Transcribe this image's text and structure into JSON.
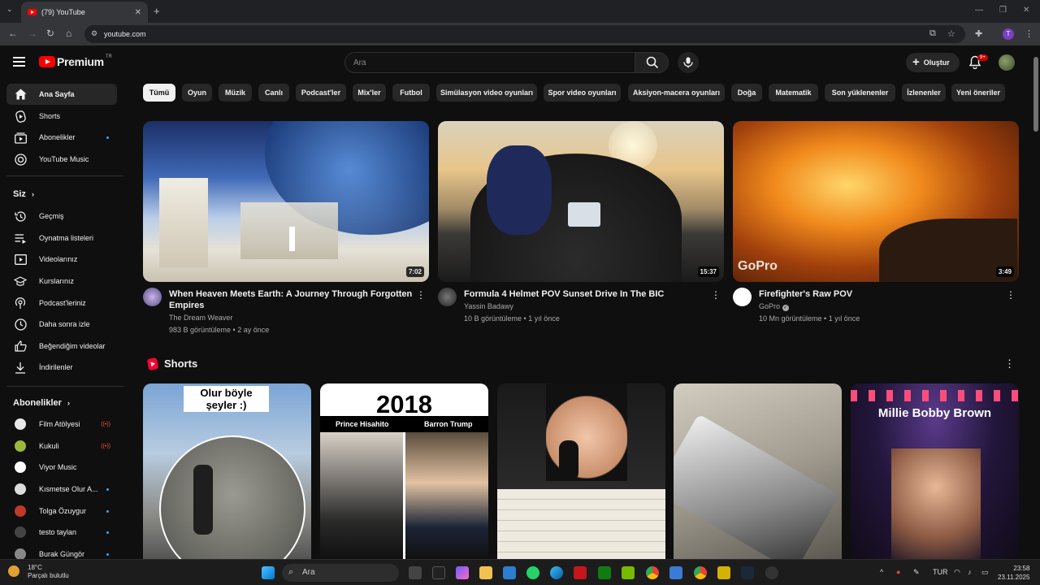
{
  "browser": {
    "tab_title": "(79) YouTube",
    "tab_close": "✕",
    "new_tab": "+",
    "url": "youtube.com"
  },
  "masthead": {
    "logo_text": "Premium",
    "logo_region": "TR",
    "search_placeholder": "Ara",
    "create_label": "Oluştur",
    "notification_count": "9+"
  },
  "sidebar": {
    "main": [
      {
        "label": "Ana Sayfa",
        "icon": "home-icon"
      },
      {
        "label": "Shorts",
        "icon": "shorts-icon"
      },
      {
        "label": "Abonelikler",
        "icon": "subscriptions-icon"
      },
      {
        "label": "YouTube Music",
        "icon": "music-icon"
      }
    ],
    "you_header": "Siz",
    "you_items": [
      {
        "label": "Geçmiş",
        "icon": "history-icon"
      },
      {
        "label": "Oynatma listeleri",
        "icon": "playlists-icon"
      },
      {
        "label": "Videolarınız",
        "icon": "your-videos-icon"
      },
      {
        "label": "Kurslarınız",
        "icon": "courses-icon"
      },
      {
        "label": "Podcast'leriniz",
        "icon": "podcasts-icon"
      },
      {
        "label": "Daha sonra izle",
        "icon": "watch-later-icon"
      },
      {
        "label": "Beğendiğim videolar",
        "icon": "liked-icon"
      },
      {
        "label": "İndirilenler",
        "icon": "download-icon"
      }
    ],
    "subs_header": "Abonelikler",
    "subscriptions": [
      {
        "label": "Film Atölyesi",
        "status": "live",
        "color": "#e8e8e8"
      },
      {
        "label": "Kukuli",
        "status": "live",
        "color": "#9ab83a"
      },
      {
        "label": "Viyor Music",
        "status": "",
        "color": "#ffffff"
      },
      {
        "label": "Kısmetse Olur A...",
        "status": "new",
        "color": "#dddddd"
      },
      {
        "label": "Tolga Özuygur",
        "status": "new",
        "color": "#c0392b"
      },
      {
        "label": "testo taylan",
        "status": "new",
        "color": "#444444"
      },
      {
        "label": "Burak Güngör",
        "status": "new",
        "color": "#888888"
      }
    ]
  },
  "chips": [
    "Tümü",
    "Oyun",
    "Müzik",
    "Canlı",
    "Podcast'ler",
    "Mix'ler",
    "Futbol",
    "Simülasyon video oyunları",
    "Spor video oyunları",
    "Aksiyon-macera oyunları",
    "Doğa",
    "Matematik",
    "Son yüklenenler",
    "İzlenenler",
    "Yeni öneriler"
  ],
  "videos": [
    {
      "title": "When Heaven Meets Earth: A Journey Through Forgotten Empires",
      "channel": "The Dream Weaver",
      "stats": "983 B görüntüleme • 2 ay önce",
      "duration": "7:02"
    },
    {
      "title": "Formula 4 Helmet POV Sunset Drive In The BIC",
      "channel": "Yassin Badawy",
      "stats": "10 B görüntüleme • 1 yıl önce",
      "duration": "15:37"
    },
    {
      "title": "Firefighter's Raw POV",
      "channel": "GoPro",
      "stats": "10 Mn görüntüleme • 1 yıl önce",
      "duration": "3:49",
      "watermark": "GoPro"
    }
  ],
  "shorts_header": "Shorts",
  "shorts": [
    {
      "caption": "Olur böyle şeyler :)"
    },
    {
      "caption": "2018",
      "left_name": "Prince Hisahito",
      "right_name": "Barron Trump"
    },
    {
      "caption": ""
    },
    {
      "caption": ""
    },
    {
      "caption": "Millie Bobby Brown"
    }
  ],
  "taskbar": {
    "temperature": "18°C",
    "weather": "Parçalı bulutlu",
    "search": "Ara",
    "language": "TUR",
    "time": "23:58",
    "date": "23.11.2025"
  }
}
